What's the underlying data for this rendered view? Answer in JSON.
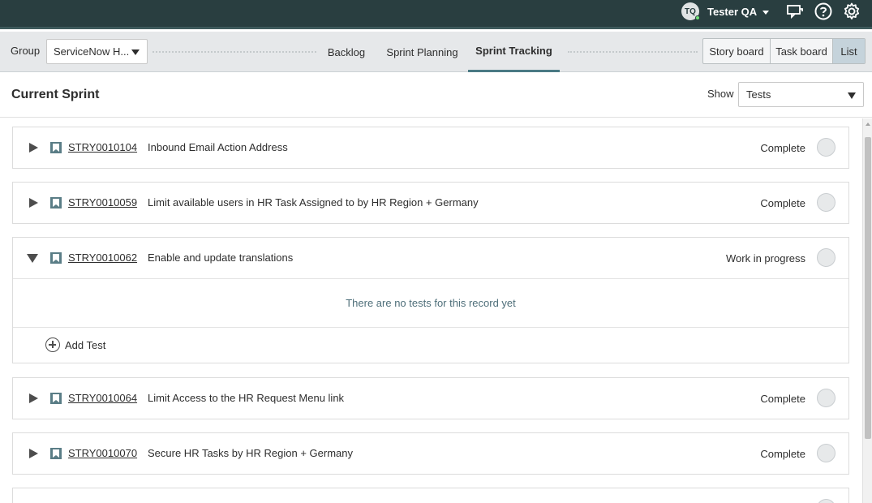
{
  "header": {
    "user_initials": "TQ",
    "user_name": "Tester QA",
    "icons": [
      "chat-icon",
      "help-icon",
      "gear-icon"
    ]
  },
  "toolbar": {
    "group_label": "Group",
    "group_value": "ServiceNow H...",
    "tabs": [
      {
        "label": "Backlog",
        "active": false
      },
      {
        "label": "Sprint Planning",
        "active": false
      },
      {
        "label": "Sprint Tracking",
        "active": true
      }
    ],
    "views": [
      {
        "label": "Story board",
        "active": false
      },
      {
        "label": "Task board",
        "active": false
      },
      {
        "label": "List",
        "active": true
      }
    ]
  },
  "titlebar": {
    "title": "Current Sprint",
    "show_label": "Show",
    "show_value": "Tests"
  },
  "stories": [
    {
      "number": "STRY0010104",
      "title": "Inbound Email Action Address",
      "state": "Complete",
      "expanded": false
    },
    {
      "number": "STRY0010059",
      "title": "Limit available users in HR Task Assigned to by HR Region + Germany",
      "state": "Complete",
      "expanded": false
    },
    {
      "number": "STRY0010062",
      "title": "Enable and update translations",
      "state": "Work in progress",
      "expanded": true,
      "empty_message": "There are no tests for this record yet",
      "add_label": "Add Test"
    },
    {
      "number": "STRY0010064",
      "title": "Limit Access to the HR Request Menu link",
      "state": "Complete",
      "expanded": false
    },
    {
      "number": "STRY0010070",
      "title": "Secure HR Tasks by HR Region + Germany",
      "state": "Complete",
      "expanded": false
    }
  ],
  "colors": {
    "header_bg": "#293e40",
    "toolbar_bg": "#e6e8ea",
    "accent": "#4a7a84",
    "story_icon": "#5a7d86"
  }
}
